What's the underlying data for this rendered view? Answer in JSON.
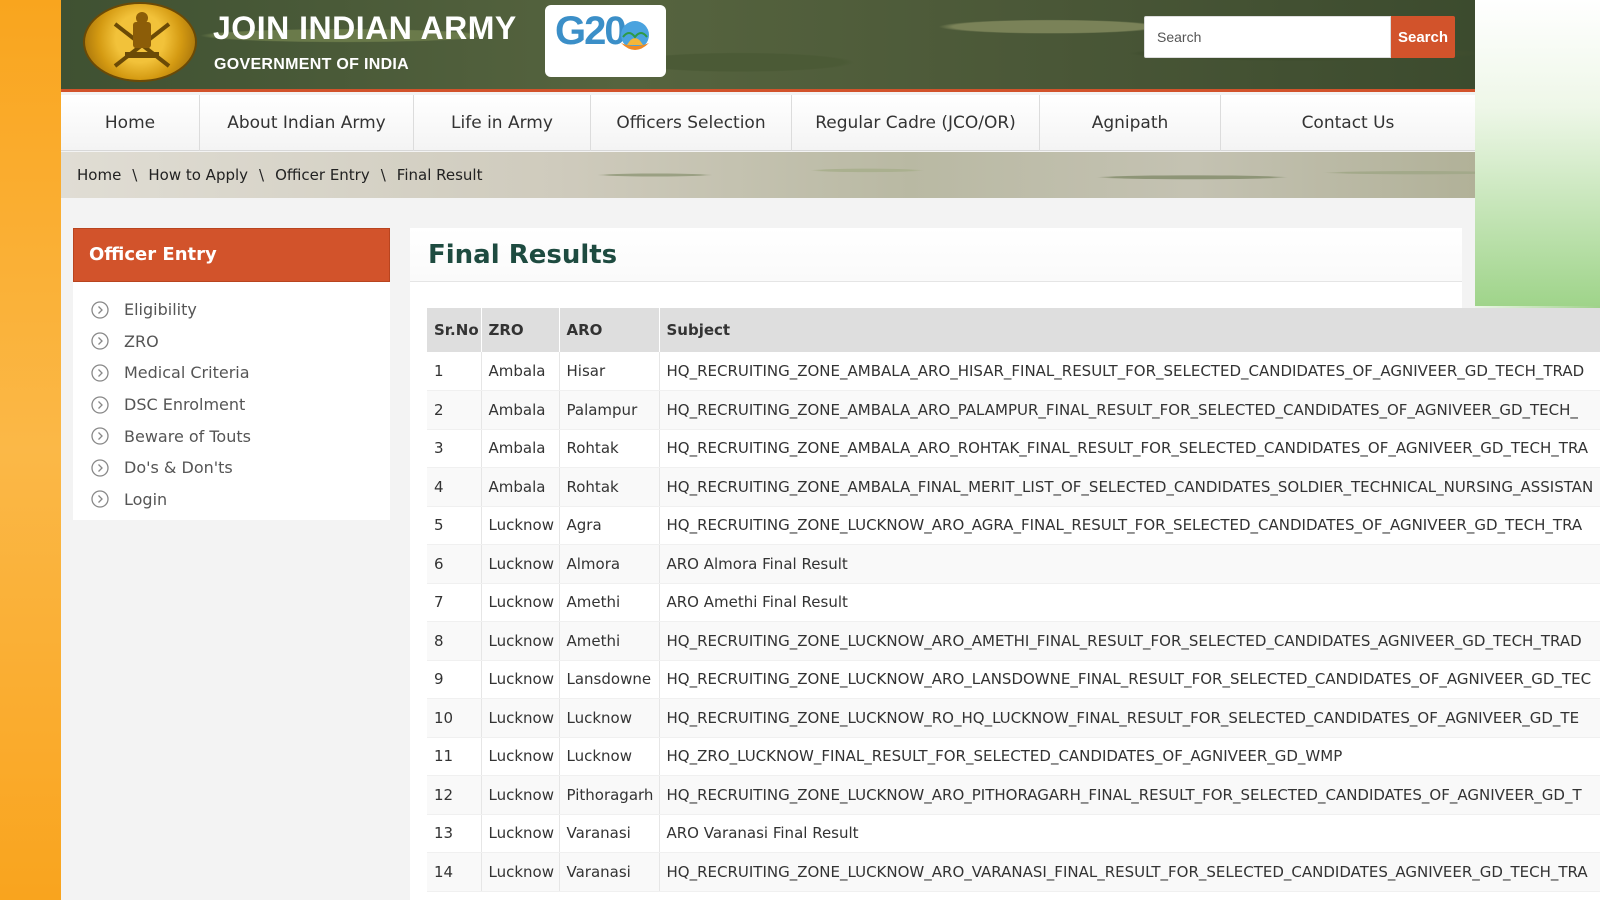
{
  "header": {
    "site_title": "JOIN INDIAN ARMY",
    "site_subtitle": "GOVERNMENT OF INDIA",
    "g20_logo_text": "G20",
    "search": {
      "placeholder": "Search",
      "button_label": "Search"
    }
  },
  "nav": {
    "items": [
      {
        "label": "Home"
      },
      {
        "label": "About Indian Army"
      },
      {
        "label": "Life in Army"
      },
      {
        "label": "Officers Selection"
      },
      {
        "label": "Regular Cadre (JCO/OR)"
      },
      {
        "label": "Agnipath"
      },
      {
        "label": "Contact Us"
      }
    ]
  },
  "breadcrumb": {
    "items": [
      "Home",
      "How to Apply",
      "Officer Entry",
      "Final Result"
    ],
    "separator": "\\"
  },
  "sidebar": {
    "title": "Officer Entry",
    "items": [
      {
        "label": "Eligibility",
        "icon": "chevron-circle-right-icon"
      },
      {
        "label": "ZRO",
        "icon": "chevron-circle-right-icon"
      },
      {
        "label": "Medical Criteria",
        "icon": "chevron-circle-right-icon"
      },
      {
        "label": "DSC Enrolment",
        "icon": "chevron-circle-right-icon"
      },
      {
        "label": "Beware of Touts",
        "icon": "chevron-circle-right-icon"
      },
      {
        "label": "Do's & Don'ts",
        "icon": "chevron-circle-right-icon"
      },
      {
        "label": "Login",
        "icon": "chevron-circle-right-icon"
      }
    ]
  },
  "main": {
    "title": "Final Results",
    "table": {
      "headers": [
        "Sr.No",
        "ZRO",
        "ARO",
        "Subject"
      ],
      "rows": [
        [
          "1",
          "Ambala",
          "Hisar",
          "HQ_RECRUITING_ZONE_AMBALA_ARO_HISAR_FINAL_RESULT_FOR_SELECTED_CANDIDATES_OF_AGNIVEER_GD_TECH_TRAD"
        ],
        [
          "2",
          "Ambala",
          "Palampur",
          "HQ_RECRUITING_ZONE_AMBALA_ARO_PALAMPUR_FINAL_RESULT_FOR_SELECTED_CANDIDATES_OF_AGNIVEER_GD_TECH_"
        ],
        [
          "3",
          "Ambala",
          "Rohtak",
          "HQ_RECRUITING_ZONE_AMBALA_ARO_ROHTAK_FINAL_RESULT_FOR_SELECTED_CANDIDATES_OF_AGNIVEER_GD_TECH_TRA"
        ],
        [
          "4",
          "Ambala",
          "Rohtak",
          "HQ_RECRUITING_ZONE_AMBALA_FINAL_MERIT_LIST_OF_SELECTED_CANDIDATES_SOLDIER_TECHNICAL_NURSING_ASSISTAN"
        ],
        [
          "5",
          "Lucknow",
          "Agra",
          "HQ_RECRUITING_ZONE_LUCKNOW_ARO_AGRA_FINAL_RESULT_FOR_SELECTED_CANDIDATES_OF_AGNIVEER_GD_TECH_TRA"
        ],
        [
          "6",
          "Lucknow",
          "Almora",
          "ARO Almora Final Result"
        ],
        [
          "7",
          "Lucknow",
          "Amethi",
          "ARO Amethi Final Result"
        ],
        [
          "8",
          "Lucknow",
          "Amethi",
          "HQ_RECRUITING_ZONE_LUCKNOW_ARO_AMETHI_FINAL_RESULT_FOR_SELECTED_CANDIDATES_AGNIVEER_GD_TECH_TRAD"
        ],
        [
          "9",
          "Lucknow",
          "Lansdowne",
          "HQ_RECRUITING_ZONE_LUCKNOW_ARO_LANSDOWNE_FINAL_RESULT_FOR_SELECTED_CANDIDATES_OF_AGNIVEER_GD_TEC"
        ],
        [
          "10",
          "Lucknow",
          "Lucknow",
          "HQ_RECRUITING_ZONE_LUCKNOW_RO_HQ_LUCKNOW_FINAL_RESULT_FOR_SELECTED_CANDIDATES_OF_AGNIVEER_GD_TE"
        ],
        [
          "11",
          "Lucknow",
          "Lucknow",
          "HQ_ZRO_LUCKNOW_FINAL_RESULT_FOR_SELECTED_CANDIDATES_OF_AGNIVEER_GD_WMP"
        ],
        [
          "12",
          "Lucknow",
          "Pithoragarh",
          "HQ_RECRUITING_ZONE_LUCKNOW_ARO_PITHORAGARH_FINAL_RESULT_FOR_SELECTED_CANDIDATES_OF_AGNIVEER_GD_T"
        ],
        [
          "13",
          "Lucknow",
          "Varanasi",
          "ARO Varanasi Final Result"
        ],
        [
          "14",
          "Lucknow",
          "Varanasi",
          "HQ_RECRUITING_ZONE_LUCKNOW_ARO_VARANASI_FINAL_RESULT_FOR_SELECTED_CANDIDATES_AGNIVEER_GD_TECH_TRA"
        ]
      ]
    }
  },
  "colors": {
    "accent": "#d2532b",
    "header_green": "#4a5737",
    "title_green": "#1e4b40",
    "saffron": "#f9a51e"
  }
}
